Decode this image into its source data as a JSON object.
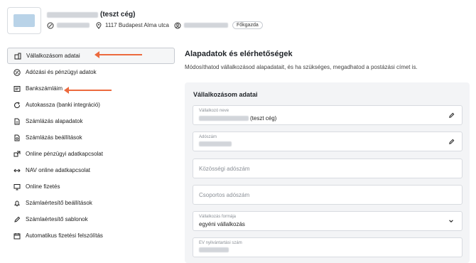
{
  "header": {
    "company_suffix": "(teszt cég)",
    "address": "1117 Budapest Alma utca",
    "role_badge": "Főkgazda"
  },
  "sidebar": {
    "items": [
      {
        "label": "Vállalkozásom adatai",
        "icon": "building-icon",
        "active": true
      },
      {
        "label": "Adózási és pénzügyi adatok",
        "icon": "percent-icon"
      },
      {
        "label": "Bankszámláim",
        "icon": "card-icon"
      },
      {
        "label": "Autokassza (banki integráció)",
        "icon": "sync-icon"
      },
      {
        "label": "Számlázás alapadatok",
        "icon": "document-icon"
      },
      {
        "label": "Számlázás beállítások",
        "icon": "document-settings-icon"
      },
      {
        "label": "Online pénzügyi adatkapcsolat",
        "icon": "link-icon"
      },
      {
        "label": "NAV online adatkapcsolat",
        "icon": "transfer-icon"
      },
      {
        "label": "Online fizetés",
        "icon": "monitor-icon"
      },
      {
        "label": "Számlaértesítő beállítások",
        "icon": "bell-settings-icon"
      },
      {
        "label": "Számlaértesítő sablonok",
        "icon": "pen-icon"
      },
      {
        "label": "Automatikus fizetési felszólítás",
        "icon": "calendar-icon"
      }
    ]
  },
  "main": {
    "title": "Alapadatok és elérhetőségek",
    "subtitle": "Módosíthatod vállalkozásod alapadatait, és ha szükséges, megadhatod a postázási címet is.",
    "panel_title": "Vállalkozásom adatai",
    "fields": {
      "company_name": {
        "label": "Vállalkozó neve",
        "value_suffix": "(teszt cég)"
      },
      "tax_number": {
        "label": "Adószám"
      },
      "community_tax": {
        "placeholder": "Közösségi adószám"
      },
      "group_tax": {
        "placeholder": "Csoportos adószám"
      },
      "business_form": {
        "label": "Vállalkozás formája",
        "value": "egyéni vállalkozás"
      },
      "ev_number": {
        "label": "EV nyilvántartási szám"
      }
    }
  },
  "colors": {
    "accent_arrow": "#ec6a3e",
    "panel_bg": "#f3f4f6"
  }
}
